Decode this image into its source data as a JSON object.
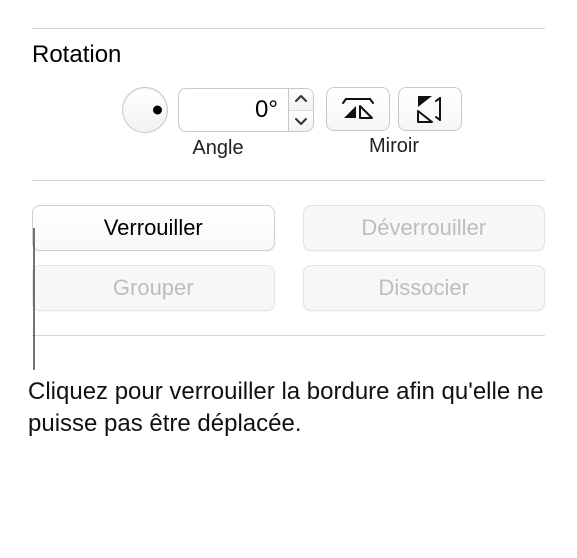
{
  "rotation": {
    "title": "Rotation",
    "angle_value": "0°",
    "angle_label": "Angle",
    "mirror_label": "Miroir"
  },
  "buttons": {
    "lock": "Verrouiller",
    "unlock": "Déverrouiller",
    "group": "Grouper",
    "ungroup": "Dissocier"
  },
  "callout": {
    "text": "Cliquez pour verrouiller la bordure afin qu'elle ne puisse pas être déplacée."
  }
}
